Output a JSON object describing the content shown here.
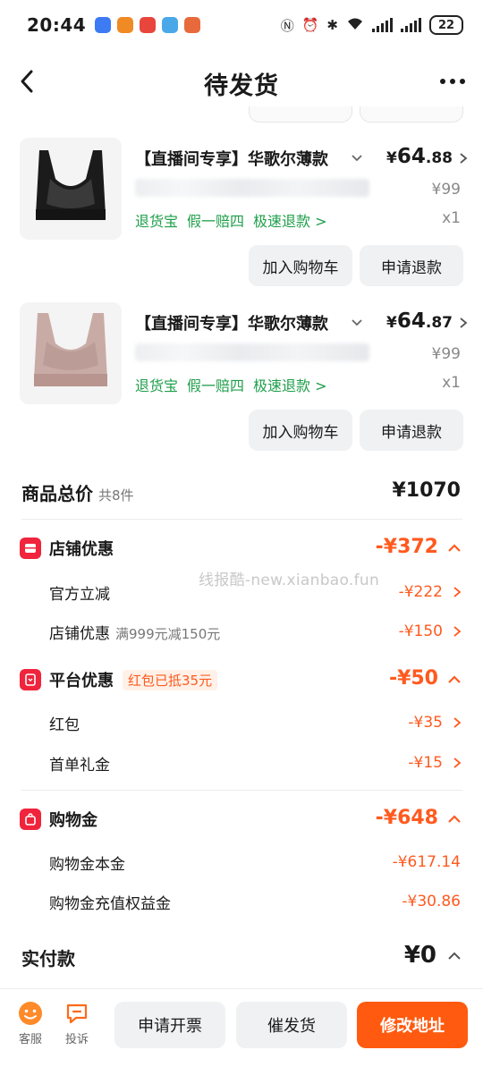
{
  "status_bar": {
    "time": "20:44",
    "battery": "22",
    "app_icon_colors": [
      "#3d7bf5",
      "#f08a24",
      "#e8453c",
      "#4aa8e8",
      "#e86a3c"
    ]
  },
  "nav": {
    "title": "待发货"
  },
  "products": [
    {
      "title": "【直播间专享】华歌尔薄款",
      "price_currency": "¥",
      "price_int": "64",
      "price_dec": ".88",
      "original_price": "¥99",
      "tags": [
        "退货宝",
        "假一赔四",
        "极速退款 >"
      ],
      "quantity": "x1",
      "add_cart_label": "加入购物车",
      "refund_label": "申请退款",
      "image_color": "black-bra"
    },
    {
      "title": "【直播间专享】华歌尔薄款",
      "price_currency": "¥",
      "price_int": "64",
      "price_dec": ".87",
      "original_price": "¥99",
      "tags": [
        "退货宝",
        "假一赔四",
        "极速退款 >"
      ],
      "quantity": "x1",
      "add_cart_label": "加入购物车",
      "refund_label": "申请退款",
      "image_color": "pink-bra"
    }
  ],
  "summary": {
    "total_label": "商品总价",
    "total_count": "共8件",
    "total_value": "¥1070",
    "store_discount": {
      "label": "店铺优惠",
      "value": "-¥372",
      "items": [
        {
          "label": "官方立减",
          "note": "",
          "value": "-¥222"
        },
        {
          "label": "店铺优惠",
          "note": "满999元减150元",
          "value": "-¥150"
        }
      ]
    },
    "platform_discount": {
      "label": "平台优惠",
      "pill": "红包已抵35元",
      "value": "-¥50",
      "items": [
        {
          "label": "红包",
          "value": "-¥35"
        },
        {
          "label": "首单礼金",
          "value": "-¥15"
        }
      ]
    },
    "shopping_credit": {
      "label": "购物金",
      "value": "-¥648",
      "items": [
        {
          "label": "购物金本金",
          "value": "-¥617.14"
        },
        {
          "label": "购物金充值权益金",
          "value": "-¥30.86"
        }
      ]
    },
    "paid_label": "实付款",
    "paid_value": "¥0"
  },
  "watermark": "线报酷-new.xianbao.fun",
  "bottom_bar": {
    "service_label": "客服",
    "complaint_label": "投诉",
    "invoice_label": "申请开票",
    "urge_label": "催发货",
    "address_label": "修改地址"
  },
  "colors": {
    "accent": "#ff5a0f",
    "discount": "#ff5a1f",
    "tag_green": "#1e9e4a",
    "icon_red": "#f0243c"
  }
}
